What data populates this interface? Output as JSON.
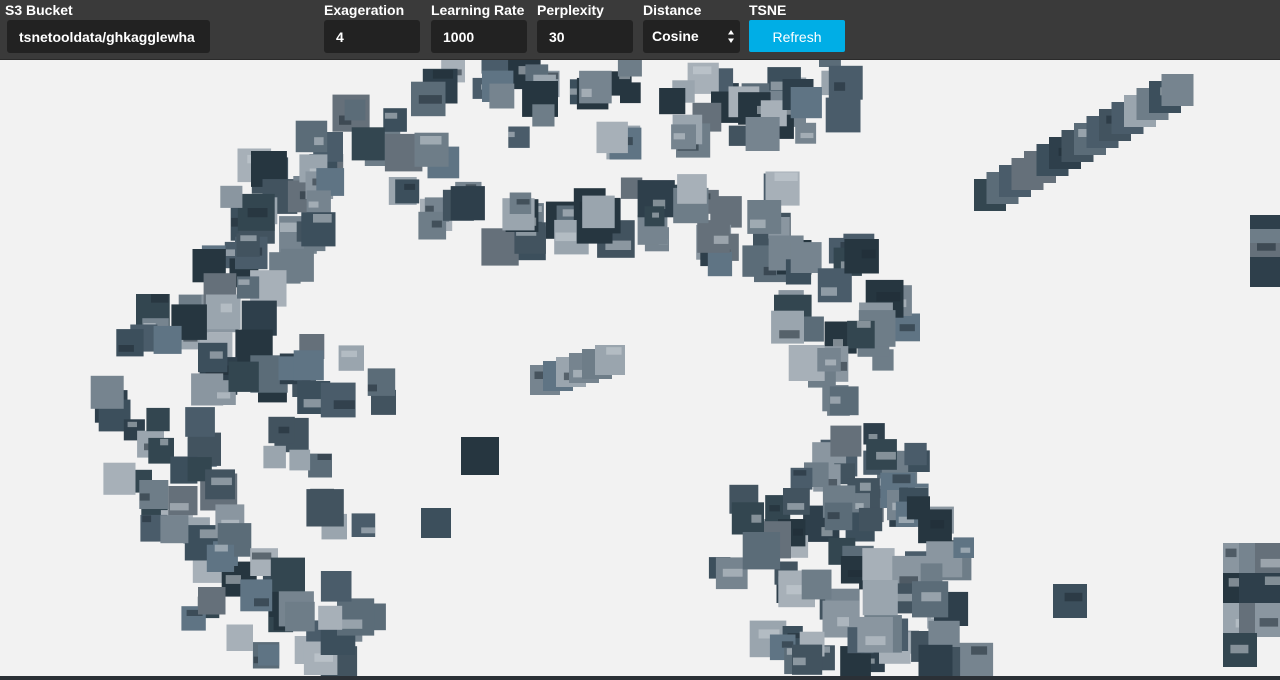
{
  "toolbar": {
    "bucket": {
      "label": "S3 Bucket",
      "value": "tsnetooldata/ghkagglewha"
    },
    "exaggeration": {
      "label": "Exageration",
      "value": "4"
    },
    "learning_rate": {
      "label": "Learning Rate",
      "value": "1000"
    },
    "perplexity": {
      "label": "Perplexity",
      "value": "30"
    },
    "distance": {
      "label": "Distance",
      "selected": "Cosine"
    },
    "tsne": {
      "label": "TSNE",
      "button_label": "Refresh"
    }
  },
  "colors": {
    "toolbar_bg": "#3a3a3a",
    "input_bg": "#222222",
    "accent": "#00aee6",
    "canvas_bg": "#f2f2f2"
  }
}
